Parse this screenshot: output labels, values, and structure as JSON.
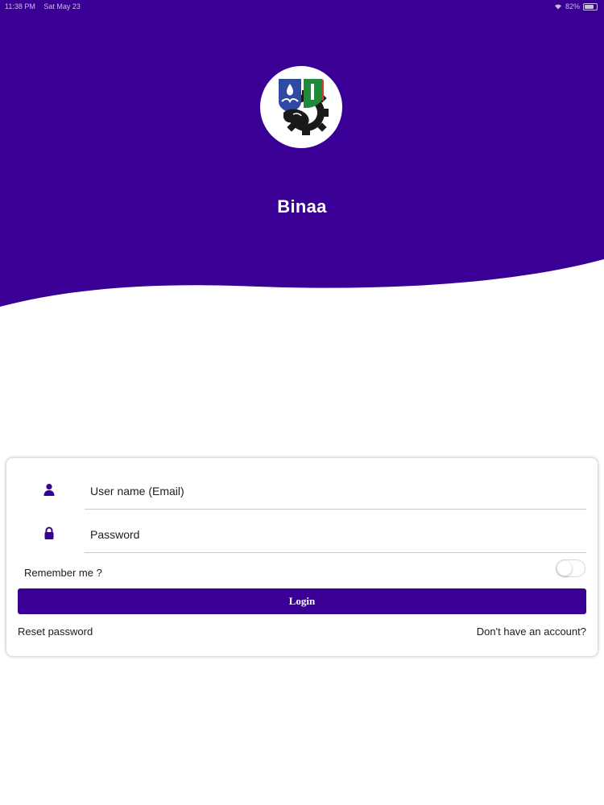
{
  "status_bar": {
    "time": "11:38 PM",
    "date": "Sat May 23",
    "battery": "82%"
  },
  "header": {
    "app_name": "Binaa",
    "logo_icon": "institution-emblem-icon",
    "background_color": "#3a0096"
  },
  "login_form": {
    "username_placeholder": "User name (Email)",
    "password_placeholder": "Password",
    "remember_label": "Remember me ?",
    "remember_enabled": false,
    "login_label": "Login",
    "reset_label": "Reset password",
    "signup_label": "Don't have an account?",
    "user_icon": "user-icon",
    "lock_icon": "lock-icon",
    "accent_color": "#3a0096"
  }
}
